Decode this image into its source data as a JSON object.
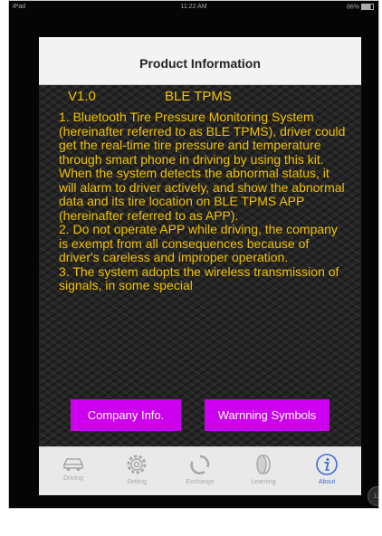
{
  "statusbar": {
    "left": "iPad",
    "time": "11:22 AM",
    "battery": "86%"
  },
  "header": {
    "title": "Product Information"
  },
  "content": {
    "version": "V1.0",
    "app_title": "BLE TPMS",
    "paragraphs": [
      "1. Bluetooth Tire Pressure Monitoring System (hereinafter referred to as BLE TPMS), driver could get the real-time tire pressure and temperature through smart phone in driving by using this kit. When the system detects the abnormal status, it will alarm to driver actively, and show the abnormal data and its tire location on BLE TPMS APP (hereinafter referred to as APP).",
      "2. Do not operate APP while driving, the company is exempt from all consequences because of driver's careless and improper operation.",
      "3. The system adopts the wireless transmission of signals, in some special"
    ]
  },
  "buttons": {
    "company": "Company Info.",
    "warning": "Warnning Symbols"
  },
  "tabs": [
    {
      "label": "Driving",
      "icon": "car-icon",
      "active": false
    },
    {
      "label": "Setting",
      "icon": "gear-icon",
      "active": false
    },
    {
      "label": "Exchange",
      "icon": "exchange-icon",
      "active": false
    },
    {
      "label": "Learning",
      "icon": "tire-icon",
      "active": false
    },
    {
      "label": "About",
      "icon": "info-icon",
      "active": true
    }
  ],
  "assistive_touch": {
    "label": "1X"
  },
  "colors": {
    "text": "#f2c200",
    "button": "#cc00ee",
    "active_tab": "#3c6ddc"
  }
}
